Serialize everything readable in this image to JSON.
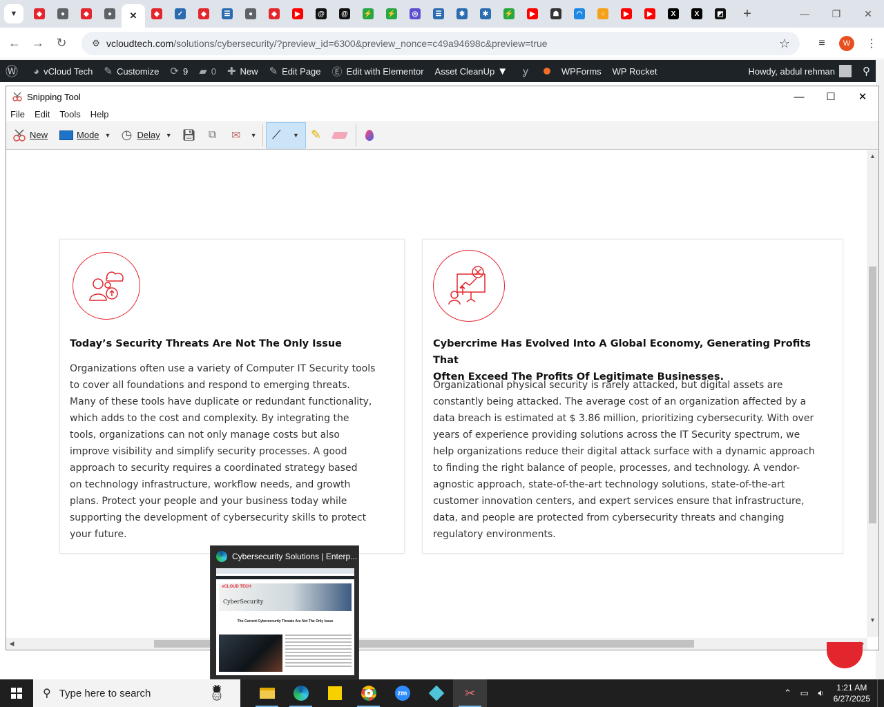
{
  "browser": {
    "tabs": [
      {
        "icon": "tab-icon-1",
        "color": "#e3262d",
        "glyph": "◆"
      },
      {
        "icon": "tab-icon-2",
        "color": "#5f6368",
        "glyph": "●"
      },
      {
        "icon": "tab-icon-3",
        "color": "#e3262d",
        "glyph": "◆"
      },
      {
        "icon": "tab-icon-4",
        "color": "#5f6368",
        "glyph": "●"
      },
      {
        "icon": "close-icon",
        "color": "#202124",
        "glyph": "✕",
        "active": true
      },
      {
        "icon": "tab-icon-6",
        "color": "#e3262d",
        "glyph": "◆"
      },
      {
        "icon": "tab-icon-7",
        "color": "#2b6cb0",
        "glyph": "✓"
      },
      {
        "icon": "tab-icon-8",
        "color": "#e3262d",
        "glyph": "◆"
      },
      {
        "icon": "tab-icon-9",
        "color": "#2b6cb0",
        "glyph": "☰"
      },
      {
        "icon": "tab-icon-10",
        "color": "#5f6368",
        "glyph": "●"
      },
      {
        "icon": "tab-icon-11",
        "color": "#e3262d",
        "glyph": "◆"
      },
      {
        "icon": "youtube-icon",
        "color": "#ff0000",
        "glyph": "▶"
      },
      {
        "icon": "threads-icon",
        "color": "#111111",
        "glyph": "@"
      },
      {
        "icon": "threads-icon",
        "color": "#111111",
        "glyph": "@"
      },
      {
        "icon": "tab-icon-15",
        "color": "#27a844",
        "glyph": "⚡"
      },
      {
        "icon": "tab-icon-16",
        "color": "#27a844",
        "glyph": "⚡"
      },
      {
        "icon": "tab-icon-17",
        "color": "#5a4fcf",
        "glyph": "◎"
      },
      {
        "icon": "tab-icon-18",
        "color": "#2b6cb0",
        "glyph": "☰"
      },
      {
        "icon": "tab-icon-19",
        "color": "#2b6cb0",
        "glyph": "✱"
      },
      {
        "icon": "tab-icon-20",
        "color": "#2b6cb0",
        "glyph": "✱"
      },
      {
        "icon": "tab-icon-21",
        "color": "#27a844",
        "glyph": "⚡"
      },
      {
        "icon": "youtube-icon",
        "color": "#ff0000",
        "glyph": "▶"
      },
      {
        "icon": "tab-icon-23",
        "color": "#333333",
        "glyph": "☗"
      },
      {
        "icon": "tab-icon-24",
        "color": "#1e88e5",
        "glyph": "◠"
      },
      {
        "icon": "tab-icon-25",
        "color": "#f4a11a",
        "glyph": "○"
      },
      {
        "icon": "youtube-icon",
        "color": "#ff0000",
        "glyph": "▶"
      },
      {
        "icon": "youtube-icon",
        "color": "#ff0000",
        "glyph": "▶"
      },
      {
        "icon": "x-icon",
        "color": "#000000",
        "glyph": "X"
      },
      {
        "icon": "x-icon",
        "color": "#000000",
        "glyph": "X"
      },
      {
        "icon": "tab-icon-30",
        "color": "#111111",
        "glyph": "◩"
      }
    ],
    "url_host": "vcloudtech.com",
    "url_rest": "/solutions/cybersecurity/?preview_id=6300&preview_nonce=c49a94698c&preview=true",
    "profile_initial": "W"
  },
  "wpbar": {
    "site": "vCloud Tech",
    "customize": "Customize",
    "updates": "9",
    "comments": "0",
    "new": "New",
    "edit_page": "Edit Page",
    "elementor": "Edit with Elementor",
    "asset_cleanup": "Asset CleanUp",
    "wpforms": "WPForms",
    "wprocket": "WP Rocket",
    "howdy": "Howdy, abdul rehman"
  },
  "snipping": {
    "title": "Snipping Tool",
    "menu": [
      "File",
      "Edit",
      "Tools",
      "Help"
    ],
    "new_label": "New",
    "mode_label": "Mode",
    "delay_label": "Delay"
  },
  "cards": {
    "left": {
      "heading": "Today’s Security Threats Are Not The Only Issue",
      "lines": [
        "Organizations often use a variety of Computer IT Security tools",
        "to cover all foundations and respond to emerging threats.",
        "Many of these tools have duplicate or redundant functionality,",
        "which adds to the cost and complexity. By integrating the",
        "tools, organizations can not only manage costs but also",
        "improve visibility and simplify security processes. A good",
        "approach to security requires a coordinated strategy based",
        "on technology infrastructure, workflow needs, and growth",
        "plans. Protect your people and your business today while",
        "supporting the development of cybersecurity skills to protect",
        "your future."
      ]
    },
    "right": {
      "heading_lines": [
        "Cybercrime Has Evolved Into A Global Economy, Generating Profits That",
        "Often Exceed The Profits Of Legitimate Businesses."
      ],
      "lines": [
        "Organizational physical security is rarely attacked, but digital assets are",
        "constantly being attacked. The average cost of an organization affected by a",
        "data breach is estimated at $ 3.86 million, prioritizing cybersecurity. With over",
        "years of experience providing solutions across the IT Security spectrum, we",
        "help organizations reduce their digital attack surface with a dynamic approach",
        "to finding the right balance of people, processes, and technology. A vendor-",
        "agnostic approach, state-of-the-art technology solutions, state-of-the-art",
        "customer innovation centers, and expert services ensure that infrastructure,",
        "data, and people are protected from cybersecurity threats and changing",
        "regulatory environments."
      ]
    }
  },
  "preview": {
    "title": "Cybersecurity Solutions | Enterp...",
    "thumb_title": "CyberSecurity",
    "thumb_heading": "The Current Cybersecurity Threats Are Not The Only Issue"
  },
  "taskbar": {
    "search_placeholder": "Type here to search",
    "time": "1:21 AM",
    "date": "6/27/2025"
  },
  "colors": {
    "accent_red": "#e3262d",
    "wp_bar": "#1d2327"
  }
}
